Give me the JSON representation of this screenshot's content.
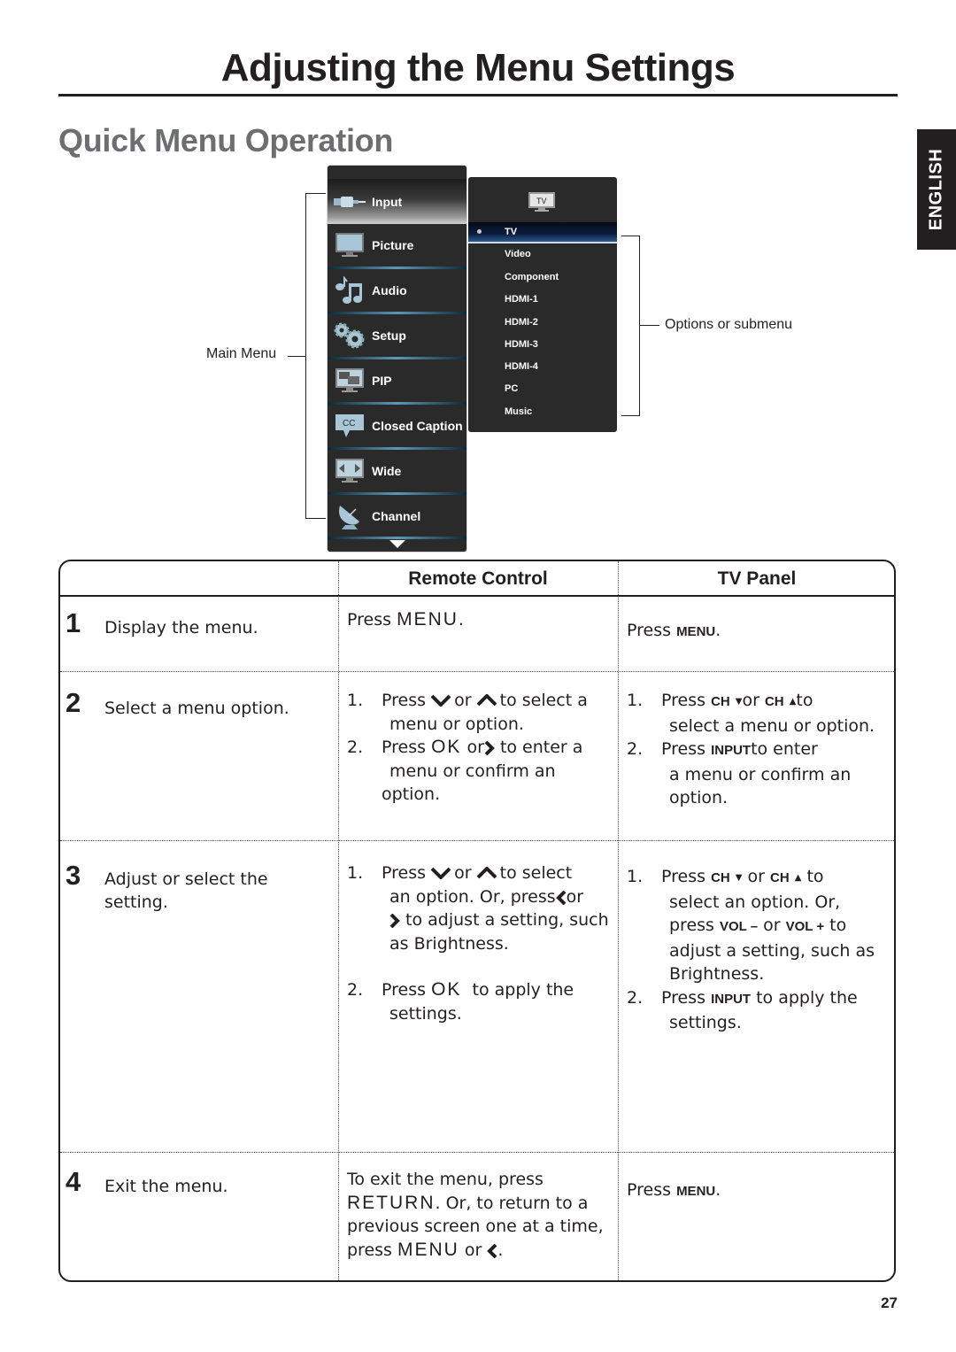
{
  "header": {
    "title": "Adjusting the Menu Settings",
    "section": "Quick Menu Operation",
    "language_tab": "ENGLISH"
  },
  "diagram": {
    "main_menu_label": "Main Menu",
    "submenu_label": "Options or submenu",
    "main_menu": [
      {
        "label": "Input",
        "icon": "input-cable-icon",
        "selected": true
      },
      {
        "label": "Picture",
        "icon": "tv-picture-icon",
        "selected": false
      },
      {
        "label": "Audio",
        "icon": "music-note-icon",
        "selected": false
      },
      {
        "label": "Setup",
        "icon": "gears-icon",
        "selected": false
      },
      {
        "label": "PIP",
        "icon": "pip-icon",
        "selected": false
      },
      {
        "label": "Closed Caption",
        "icon": "cc-icon",
        "selected": false
      },
      {
        "label": "Wide",
        "icon": "wide-icon",
        "selected": false
      },
      {
        "label": "Channel",
        "icon": "satellite-dish-icon",
        "selected": false
      }
    ],
    "submenu_header_icon_text": "TV",
    "submenu": [
      {
        "label": "TV",
        "selected": true
      },
      {
        "label": "Video",
        "selected": false
      },
      {
        "label": "Component",
        "selected": false
      },
      {
        "label": "HDMI-1",
        "selected": false
      },
      {
        "label": "HDMI-2",
        "selected": false
      },
      {
        "label": "HDMI-3",
        "selected": false
      },
      {
        "label": "HDMI-4",
        "selected": false
      },
      {
        "label": "PC",
        "selected": false
      },
      {
        "label": "Music",
        "selected": false
      }
    ]
  },
  "table": {
    "headers": [
      "",
      "Remote Control",
      "TV Panel"
    ],
    "rows": [
      {
        "num": "1",
        "desc": "Display the menu.",
        "remote": {
          "press": "Press",
          "key": "MENU",
          "end": "."
        },
        "panel": {
          "press": "Press",
          "key": "MENU",
          "end": "."
        }
      },
      {
        "num": "2",
        "desc": "Select a menu option.",
        "remote": {
          "i1_n": "1.",
          "i1_a": "Press",
          "i1_b": "or",
          "i1_c": "to select a",
          "i1_d": "menu or option.",
          "i2_n": "2.",
          "i2_a": "Press",
          "i2_key": "OK",
          "i2_b": "or",
          "i2_c": "to enter a",
          "i2_d": "menu or confirm an option."
        },
        "panel": {
          "i1_n": "1.",
          "i1_a": "Press",
          "i1_k1": "CH",
          "i1_b": "or",
          "i1_k2": "CH",
          "i1_c": "to",
          "i1_d": "select a menu or option.",
          "i2_n": "2.",
          "i2_a": "Press",
          "i2_key": "INPUT",
          "i2_c": "to enter",
          "i2_d": "a menu or confirm an",
          "i2_e": "option."
        }
      },
      {
        "num": "3",
        "desc": "Adjust or select the setting.",
        "remote": {
          "i1_n": "1.",
          "i1_a": "Press",
          "i1_b": "or",
          "i1_c": "to select",
          "i1_d": "an option. Or, press",
          "i1_e": "or",
          "i1_f": "to adjust a setting, such",
          "i1_g": "as Brightness.",
          "i2_n": "2.",
          "i2_a": "Press",
          "i2_key": "OK",
          "i2_c": "to apply the",
          "i2_d": "settings."
        },
        "panel": {
          "i1_n": "1.",
          "i1_a": "Press",
          "i1_k1": "CH",
          "i1_b": "or",
          "i1_k2": "CH",
          "i1_c": "to",
          "i1_d": "select an option. Or,",
          "i1_e": "press",
          "i1_k3": "VOL –",
          "i1_f": "or",
          "i1_k4": "VOL +",
          "i1_g": "to",
          "i1_h": "adjust a setting, such as",
          "i1_i": "Brightness.",
          "i2_n": "2.",
          "i2_a": "Press",
          "i2_key": "INPUT",
          "i2_c": "to apply the",
          "i2_d": "settings."
        }
      },
      {
        "num": "4",
        "desc": "Exit the menu.",
        "remote": {
          "l1": "To exit the menu, press",
          "key1": "RETURN",
          "l2": ". Or, to return to a",
          "l3": "previous screen one at a time,",
          "l4a": "press",
          "key2": "MENU",
          "l4b": "or",
          "l4c": "."
        },
        "panel": {
          "press": "Press",
          "key": "MENU",
          "end": "."
        }
      }
    ]
  },
  "footer": {
    "page_number": "27"
  },
  "colors": {
    "text": "#231f20",
    "section_gray": "#6d6e71",
    "menu_bg": "#2b2a2a",
    "accent_blue": "#5e97b5"
  }
}
